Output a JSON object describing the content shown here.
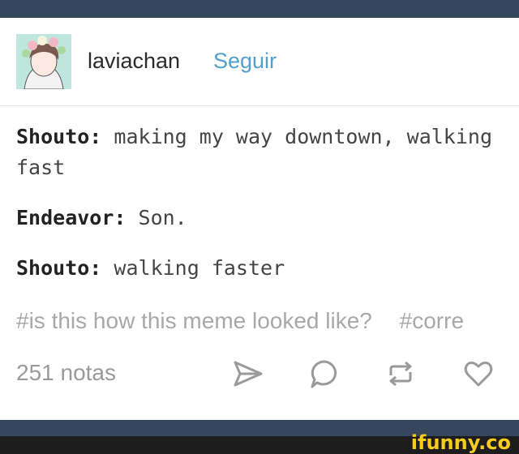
{
  "post": {
    "username": "laviachan",
    "follow_label": "Seguir",
    "chat": [
      {
        "speaker": "Shouto:",
        "text": "making my way downtown, walking fast"
      },
      {
        "speaker": "Endeavor:",
        "text": "Son."
      },
      {
        "speaker": "Shouto:",
        "text": "walking faster"
      }
    ],
    "tags": [
      "#is this how this meme looked like?",
      "#corre"
    ],
    "notes": "251 notas"
  },
  "icons": {
    "share": "paper-plane-icon",
    "reply": "speech-bubble-icon",
    "reblog": "reblog-icon",
    "like": "heart-icon"
  },
  "colors": {
    "bar": "#36465d",
    "link": "#529ecc",
    "muted": "#a8a8a8",
    "watermark": "#f7cd1b"
  },
  "watermark": "ifunny.co"
}
